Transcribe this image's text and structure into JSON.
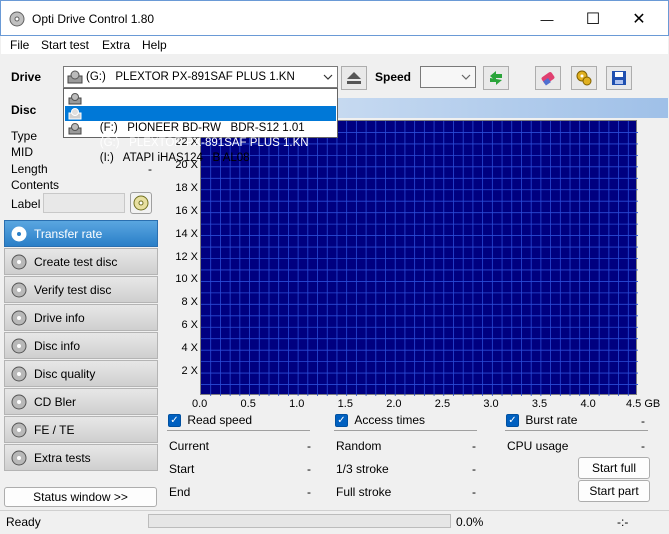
{
  "window": {
    "title": "Opti Drive Control 1.80",
    "minimize": "—",
    "maximize": "☐",
    "close": "✕"
  },
  "menu": [
    "File",
    "Start test",
    "Extra",
    "Help"
  ],
  "toolbar": {
    "drive_label": "Drive",
    "drive_selected": "(G:)   PLEXTOR PX-891SAF PLUS 1.KN",
    "speed_label": "Speed",
    "speed_value": "",
    "drive_options": [
      "(F:)   PIONEER BD-RW   BDR-S12 1.01",
      "(G:)   PLEXTOR PX-891SAF PLUS 1.KN",
      "(I:)   ATAPI iHAS124   B AL08"
    ]
  },
  "disc": {
    "title": "Disc",
    "fields": [
      {
        "label": "Type",
        "value": ""
      },
      {
        "label": "MID",
        "value": ""
      },
      {
        "label": "Length",
        "value": "-"
      },
      {
        "label": "Contents",
        "value": ""
      }
    ],
    "label_field": "Label"
  },
  "sidebar": [
    {
      "label": "Transfer rate",
      "active": true
    },
    {
      "label": "Create test disc",
      "active": false
    },
    {
      "label": "Verify test disc",
      "active": false
    },
    {
      "label": "Drive info",
      "active": false
    },
    {
      "label": "Disc info",
      "active": false
    },
    {
      "label": "Disc quality",
      "active": false
    },
    {
      "label": "CD Bler",
      "active": false
    },
    {
      "label": "FE / TE",
      "active": false
    },
    {
      "label": "Extra tests",
      "active": false
    }
  ],
  "status_window_btn": "Status window >>",
  "chart_data": {
    "type": "line",
    "y_ticks": [
      "2 X",
      "4 X",
      "6 X",
      "8 X",
      "10 X",
      "12 X",
      "14 X",
      "16 X",
      "18 X",
      "20 X",
      "22 X"
    ],
    "x_ticks": [
      "0.0",
      "0.5",
      "1.0",
      "1.5",
      "2.0",
      "2.5",
      "3.0",
      "3.5",
      "4.0",
      "4.5 GB"
    ],
    "xlim": [
      0,
      4.5
    ],
    "ylim": [
      0,
      24
    ],
    "grid": true,
    "series": []
  },
  "checks": {
    "read_speed": "Read speed",
    "access_times": "Access times",
    "burst_rate": "Burst rate"
  },
  "stats": {
    "current": {
      "label": "Current",
      "value": "-"
    },
    "start": {
      "label": "Start",
      "value": "-"
    },
    "end": {
      "label": "End",
      "value": "-"
    },
    "random": {
      "label": "Random",
      "value": "-"
    },
    "one_third": {
      "label": "1/3 stroke",
      "value": "-"
    },
    "full_stroke": {
      "label": "Full stroke",
      "value": "-"
    },
    "burst_value": "-",
    "cpu": {
      "label": "CPU usage",
      "value": "-"
    }
  },
  "buttons": {
    "start_full": "Start full",
    "start_part": "Start part"
  },
  "status": {
    "text": "Ready",
    "progress": "0.0%",
    "progress_fraction": 0.0,
    "time": "-:-"
  },
  "colors": {
    "plot_bg": "#000080",
    "grid": "#2a4bd6",
    "accent": "#0078d7"
  }
}
